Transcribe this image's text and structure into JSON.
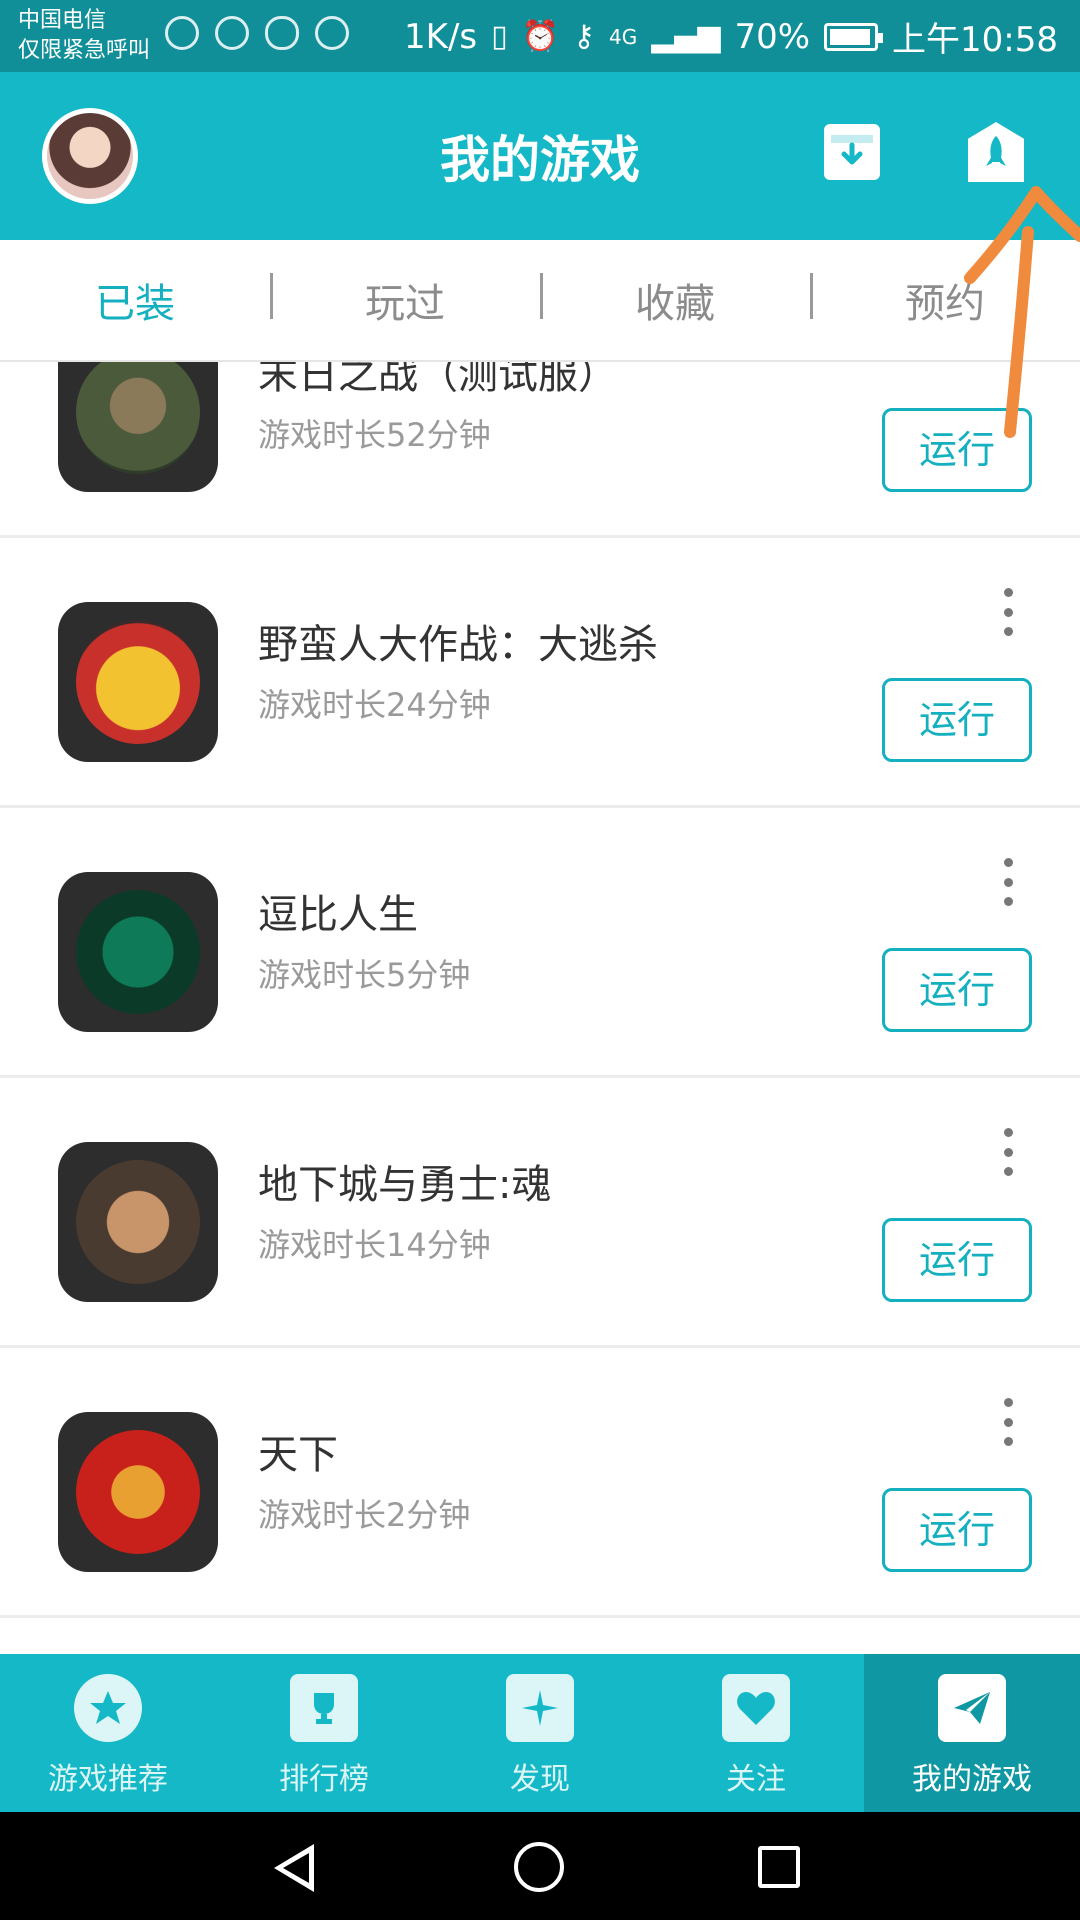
{
  "status_bar": {
    "carrier_line1": "中国电信",
    "carrier_line2": "仅限紧急呼叫",
    "speed": "1K/s",
    "network": "4G",
    "battery": "70%",
    "time": "上午10:58"
  },
  "header": {
    "title": "我的游戏",
    "avatar_icon": "avatar-icon",
    "download_icon": "download-box-icon",
    "rocket_icon": "rocket-icon"
  },
  "tabs": [
    {
      "label": "已装",
      "active": true
    },
    {
      "label": "玩过",
      "active": false
    },
    {
      "label": "收藏",
      "active": false
    },
    {
      "label": "预约",
      "active": false
    }
  ],
  "games": [
    {
      "name": "末日之战（测试服）",
      "duration": "游戏时长52分钟",
      "button": "运行"
    },
    {
      "name": "野蛮人大作战：大逃杀",
      "duration": "游戏时长24分钟",
      "button": "运行"
    },
    {
      "name": "逗比人生",
      "duration": "游戏时长5分钟",
      "button": "运行"
    },
    {
      "name": "地下城与勇士:魂",
      "duration": "游戏时长14分钟",
      "button": "运行"
    },
    {
      "name": "天下",
      "duration": "游戏时长2分钟",
      "button": "运行"
    }
  ],
  "bottom_nav": [
    {
      "label": "游戏推荐",
      "icon": "star-icon",
      "active": false
    },
    {
      "label": "排行榜",
      "icon": "trophy-icon",
      "active": false
    },
    {
      "label": "发现",
      "icon": "sparkle-icon",
      "active": false
    },
    {
      "label": "关注",
      "icon": "heart-icon",
      "active": false
    },
    {
      "label": "我的游戏",
      "icon": "paper-plane-icon",
      "active": true
    }
  ],
  "colors": {
    "primary": "#14b8c6",
    "status_bar": "#118f99",
    "accent_text": "#14b0bf",
    "annotation": "#f08a3c"
  }
}
